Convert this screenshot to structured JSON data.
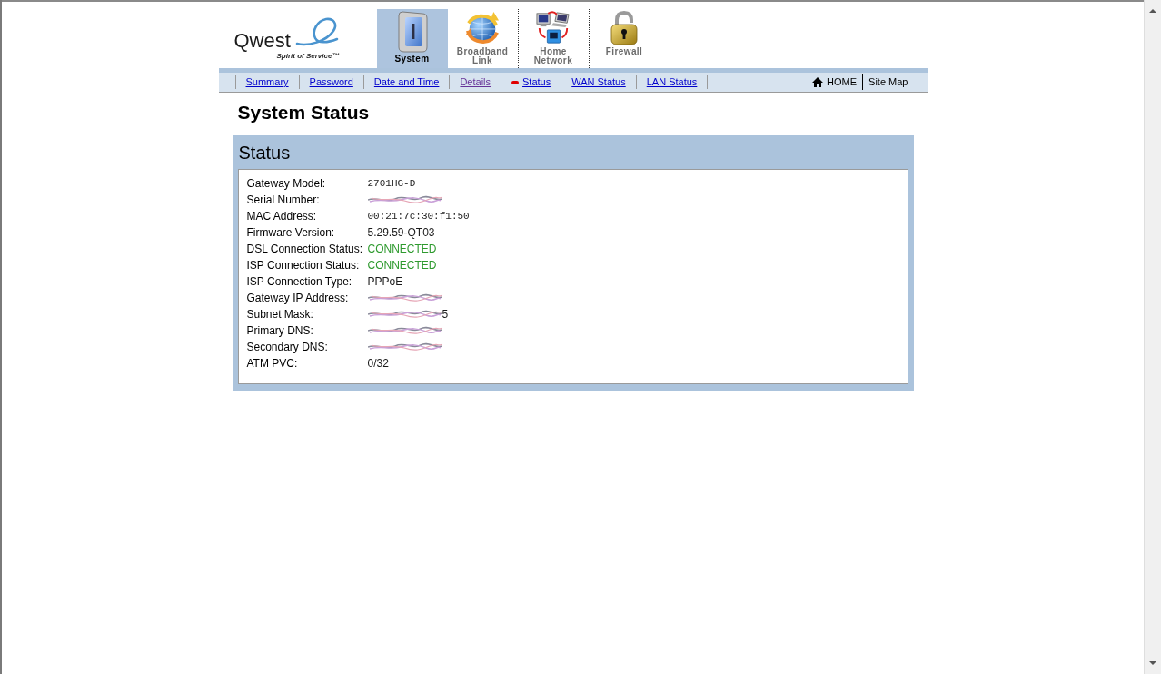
{
  "logo": {
    "name": "Qwest",
    "tagline": "Spirit of Service™"
  },
  "tabs": [
    {
      "label": "System",
      "kind": "system",
      "selected": true
    },
    {
      "label": "Broadband Link",
      "kind": "broadband",
      "selected": false
    },
    {
      "label": "Home Network",
      "kind": "network",
      "selected": false
    },
    {
      "label": "Firewall",
      "kind": "firewall",
      "selected": false
    }
  ],
  "subnav": {
    "links": [
      {
        "label": "Summary",
        "selected": false,
        "visited": false
      },
      {
        "label": "Password",
        "selected": false,
        "visited": false
      },
      {
        "label": "Date and Time",
        "selected": false,
        "visited": false
      },
      {
        "label": "Details",
        "selected": false,
        "visited": true
      },
      {
        "label": "Status",
        "selected": true,
        "visited": false
      },
      {
        "label": "WAN Status",
        "selected": false,
        "visited": false
      },
      {
        "label": "LAN Status",
        "selected": false,
        "visited": false
      }
    ],
    "home": "HOME",
    "site_map": "Site Map"
  },
  "page_title": "System Status",
  "panel": {
    "title": "Status",
    "rows": [
      {
        "label": "Gateway Model:",
        "kind": "mono",
        "value": "2701HG-D"
      },
      {
        "label": "Serial Number:",
        "kind": "redacted"
      },
      {
        "label": "MAC Address:",
        "kind": "mono",
        "value": "00:21:7c:30:f1:50"
      },
      {
        "label": "Firmware Version:",
        "kind": "text",
        "value": "5.29.59-QT03"
      },
      {
        "label": "DSL Connection Status:",
        "kind": "status",
        "value": "CONNECTED"
      },
      {
        "label": "ISP Connection Status:",
        "kind": "status",
        "value": "CONNECTED"
      },
      {
        "label": "ISP Connection Type:",
        "kind": "text",
        "value": "PPPoE"
      },
      {
        "label": "Gateway IP Address:",
        "kind": "redacted"
      },
      {
        "label": "Subnet Mask:",
        "kind": "redacted",
        "value": "5"
      },
      {
        "label": "Primary DNS:",
        "kind": "redacted"
      },
      {
        "label": "Secondary DNS:",
        "kind": "redacted"
      },
      {
        "label": "ATM PVC:",
        "kind": "text",
        "value": "0/32"
      }
    ]
  }
}
